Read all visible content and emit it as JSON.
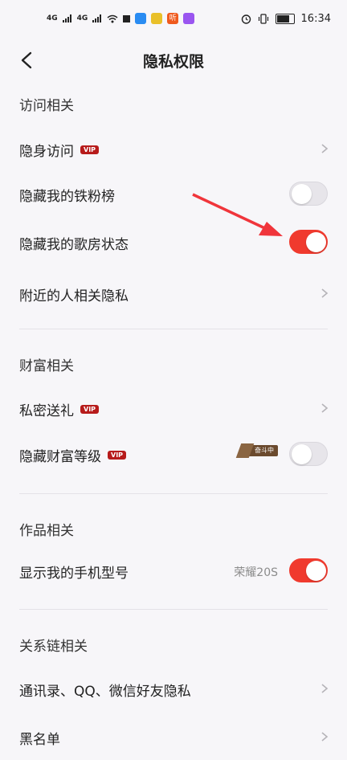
{
  "status": {
    "signal1": "4G",
    "signal2": "4G",
    "time": "16:34",
    "app_icons": [
      "#2a8cf2",
      "#e9c02a",
      "#ef5a1e",
      "#9a55f0"
    ],
    "app_icon_labels": [
      "",
      "",
      "听",
      ""
    ]
  },
  "header": {
    "title": "隐私权限"
  },
  "sections": {
    "visit": {
      "title": "访问相关"
    },
    "wealth": {
      "title": "财富相关"
    },
    "works": {
      "title": "作品相关"
    },
    "relation": {
      "title": "关系链相关"
    }
  },
  "rows": {
    "stealth_visit": {
      "label": "隐身访问",
      "badge": "VIP"
    },
    "hide_iron_fans": {
      "label": "隐藏我的铁粉榜",
      "toggle_on": false
    },
    "hide_ktv_status": {
      "label": "隐藏我的歌房状态",
      "toggle_on": true
    },
    "nearby_privacy": {
      "label": "附近的人相关隐私"
    },
    "private_gift": {
      "label": "私密送礼",
      "badge": "VIP"
    },
    "hide_wealth_level": {
      "label": "隐藏财富等级",
      "badge": "VIP",
      "status_badge": "奋斗中",
      "toggle_on": false
    },
    "show_phone_model": {
      "label": "显示我的手机型号",
      "value": "荣耀20S",
      "toggle_on": true
    },
    "contacts_privacy": {
      "label": "通讯录、QQ、微信好友隐私"
    },
    "blacklist": {
      "label": "黑名单"
    }
  },
  "colors": {
    "accent": "#f03a2e",
    "vip": "#b71b1b",
    "annotation_arrow": "#f0353b"
  }
}
